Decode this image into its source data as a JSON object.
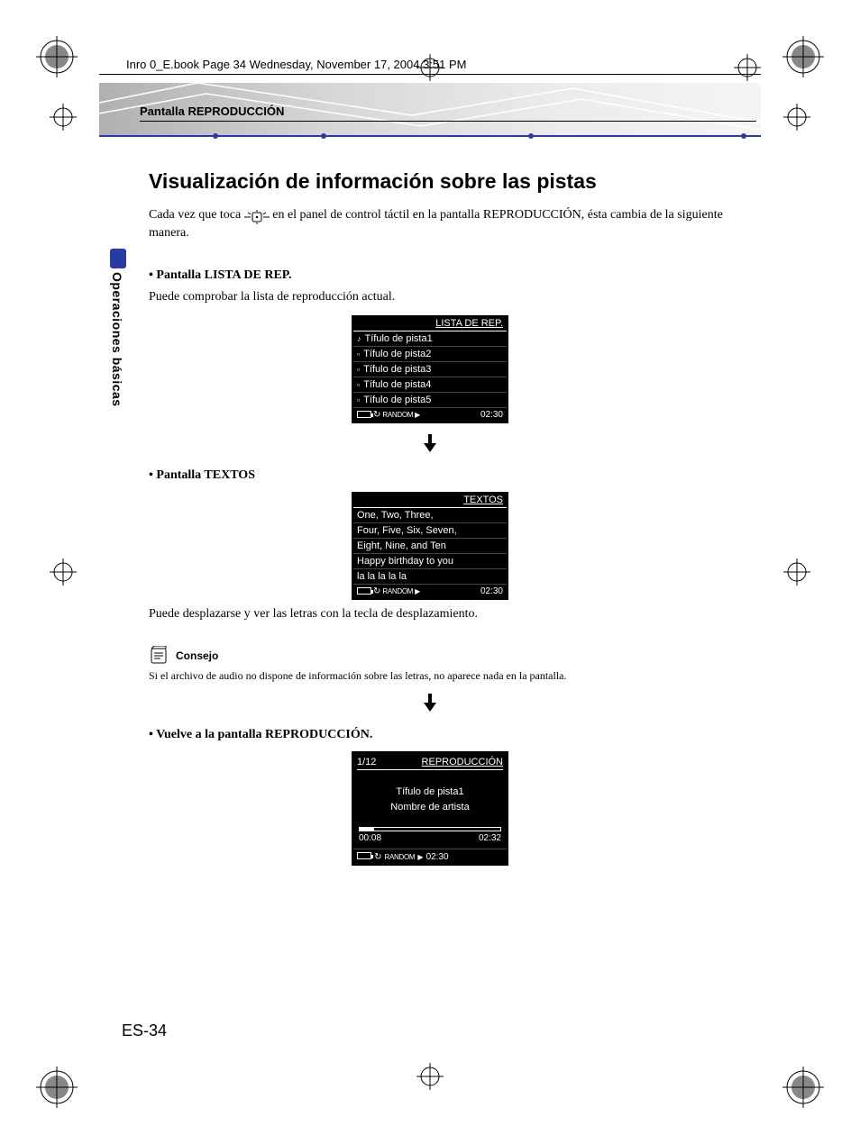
{
  "book_header": "Inro 0_E.book  Page 34  Wednesday, November 17, 2004  3:51 PM",
  "breadcrumb": "Pantalla REPRODUCCIÓN",
  "side_label": "Operaciones básicas",
  "title": "Visualización de información sobre las pistas",
  "intro_before": "Cada vez que toca ",
  "intro_after": " en el panel de control táctil en la pantalla REPRODUCCIÓN, ésta cambia de la siguiente manera.",
  "section1_head": "Pantalla LISTA DE REP.",
  "section1_body": "Puede comprobar la lista de reproducción actual.",
  "screen1": {
    "header": "LISTA DE REP.",
    "tracks": [
      "Tífulo de pista1",
      "Tífulo de pista2",
      "Tífulo de pista3",
      "Tífulo de pista4",
      "Tífulo de pista5"
    ],
    "status": {
      "random": "RANDOM",
      "play": "▶",
      "time": "02:30"
    }
  },
  "section2_head": "Pantalla TEXTOS",
  "screen2": {
    "header": "TEXTOS",
    "lines": [
      "One, Two, Three,",
      "Four, Five, Six, Seven,",
      "Eight, Nine, and Ten",
      "Happy birthday to you",
      "la la la la la"
    ],
    "status": {
      "random": "RANDOM",
      "play": "▶",
      "time": "02:30"
    }
  },
  "section2_body": "Puede desplazarse y ver las letras con la tecla de desplazamiento.",
  "tip_label": "Consejo",
  "tip_body": "Si el archivo de audio no dispone de información sobre las letras, no aparece nada en la pantalla.",
  "section3_head": "Vuelve a la pantalla REPRODUCCIÓN.",
  "screen3": {
    "counter": "1/12",
    "header": "REPRODUCCIÓN",
    "track": "Tífulo de pista1",
    "artist": "Nombre de artista",
    "elapsed": "00:08",
    "total": "02:32",
    "status": {
      "random": "RANDOM",
      "play": "▶",
      "time": "02:30"
    }
  },
  "page_number": "ES-34"
}
